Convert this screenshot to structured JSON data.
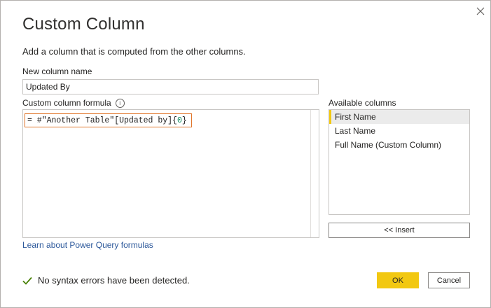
{
  "dialog": {
    "title": "Custom Column",
    "description": "Add a column that is computed from the other columns."
  },
  "new_column": {
    "label": "New column name",
    "value": "Updated By"
  },
  "formula": {
    "label": "Custom column formula",
    "info_icon": "info-icon",
    "prefix": "= #\"Another Table\"[Updated by]{",
    "index": "0",
    "suffix": "}"
  },
  "available": {
    "label": "Available columns",
    "items": [
      "First Name",
      "Last Name",
      "Full Name (Custom Column)"
    ],
    "selected_index": 0,
    "insert_label": "<< Insert"
  },
  "links": {
    "learn": "Learn about Power Query formulas"
  },
  "status": {
    "icon": "check-icon",
    "text": "No syntax errors have been detected."
  },
  "buttons": {
    "ok": "OK",
    "cancel": "Cancel"
  },
  "colors": {
    "accent": "#f2c811",
    "highlight_border": "#e0752a",
    "link": "#2b579a",
    "success": "#498205"
  }
}
